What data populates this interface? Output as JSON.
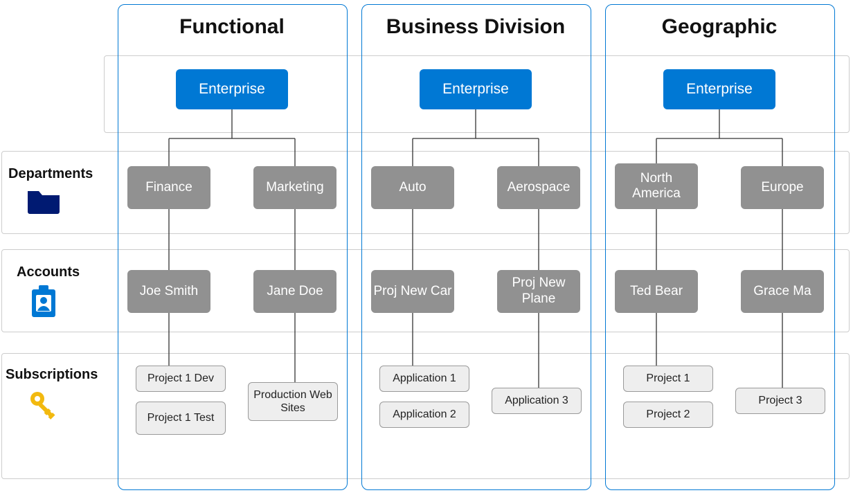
{
  "labels": {
    "departments": "Departments",
    "accounts": "Accounts",
    "subscriptions": "Subscriptions",
    "enterprise": "Enterprise"
  },
  "columns": [
    {
      "title": "Functional",
      "departments": [
        "Finance",
        "Marketing"
      ],
      "accounts": [
        "Joe Smith",
        "Jane Doe"
      ],
      "subscriptions": [
        [
          "Project 1 Dev",
          "Project 1 Test"
        ],
        [
          "Production Web Sites"
        ]
      ]
    },
    {
      "title": "Business Division",
      "departments": [
        "Auto",
        "Aerospace"
      ],
      "accounts": [
        "Proj New Car",
        "Proj New Plane"
      ],
      "subscriptions": [
        [
          "Application 1",
          "Application 2"
        ],
        [
          "Application 3"
        ]
      ]
    },
    {
      "title": "Geographic",
      "departments": [
        "North America",
        "Europe"
      ],
      "accounts": [
        "Ted Bear",
        "Grace Ma"
      ],
      "subscriptions": [
        [
          "Project 1",
          "Project 2"
        ],
        [
          "Project 3"
        ]
      ]
    }
  ],
  "icons": {
    "departments": "folder-icon",
    "accounts": "badge-icon",
    "subscriptions": "key-icon"
  },
  "colors": {
    "enterprise": "#0078d4",
    "dept": "#919191",
    "folder": "#001a72",
    "badge": "#0078d4",
    "key": "#f2b90f"
  }
}
